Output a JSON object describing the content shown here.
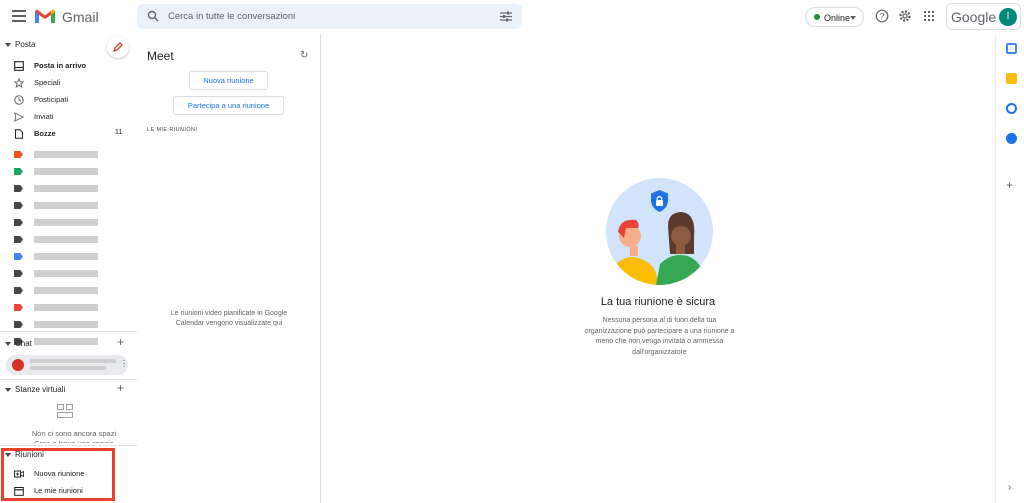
{
  "app": {
    "brand": "Gmail"
  },
  "search": {
    "placeholder": "Cerca in tutte le conversazioni"
  },
  "status": {
    "label": "Online"
  },
  "account": {
    "google_word": "Google",
    "avatar_letter": "I"
  },
  "colors": {
    "accent": "#1a73e8",
    "highlight": "#e8412c",
    "avatar": "#00897b",
    "online": "#1e8e3e"
  },
  "sidebar": {
    "mail_header": "Posta",
    "items": [
      {
        "label": "Posta in arrivo",
        "icon": "inbox-icon",
        "bold": true
      },
      {
        "label": "Speciali",
        "icon": "star-icon"
      },
      {
        "label": "Posticipati",
        "icon": "clock-icon"
      },
      {
        "label": "Inviati",
        "icon": "send-icon"
      },
      {
        "label": "Bozze",
        "icon": "draft-icon",
        "bold": true,
        "count": "11"
      }
    ],
    "labels": [
      {
        "color": "#f4511e"
      },
      {
        "color": "#16a765"
      },
      {
        "color": "#444746"
      },
      {
        "color": "#444746"
      },
      {
        "color": "#444746"
      },
      {
        "color": "#444746"
      },
      {
        "color": "#4285f4"
      },
      {
        "color": "#444746"
      },
      {
        "color": "#444746"
      },
      {
        "color": "#e8453c"
      },
      {
        "color": "#444746"
      },
      {
        "color": "#444746"
      }
    ],
    "chat_header": "Chat",
    "rooms_header": "Stanze virtuali",
    "rooms_empty": "Non ci sono ancora spazi",
    "rooms_empty_2": "Crea o trova uno spazio",
    "meetings_header": "Riunioni",
    "meetings": [
      {
        "label": "Nuova riunione",
        "icon": "video-plus-icon"
      },
      {
        "label": "Le mie riunioni",
        "icon": "calendar-icon"
      }
    ]
  },
  "meet": {
    "title": "Meet",
    "new_button": "Nuova riunione",
    "join_button": "Partecipa a una riunione",
    "my_meetings_label": "LE MIE RIUNIONI",
    "empty_text": "Le riunioni video pianificate in Google Calendar vengono visualizzate qui"
  },
  "main": {
    "title": "La tua riunione è sicura",
    "description": "Nessuna persona al di fuori della tua organizzazione può partecipare a una riunione a meno che non venga invitata o ammessa dall'organizzatore"
  }
}
